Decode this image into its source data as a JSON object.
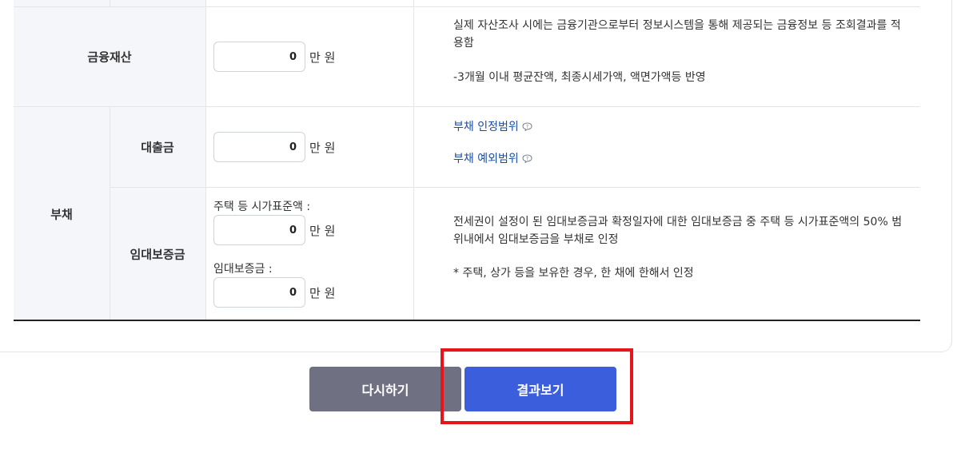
{
  "rows": {
    "financial_assets": {
      "label": "금융재산",
      "value": "0",
      "unit": "만 원",
      "desc_line1": "실제 자산조사 시에는 금융기관으로부터 정보시스템을 통해 제공되는 금융정보 등 조회결과를 적용함",
      "desc_line2": "-3개월 이내 평균잔액, 최종시세가액, 액면가액등 반영"
    },
    "debt": {
      "label": "부채",
      "loan": {
        "label": "대출금",
        "value": "0",
        "unit": "만 원",
        "link1": "부채 인정범위",
        "link2": "부채 예외범위"
      },
      "deposit": {
        "label": "임대보증금",
        "sub1": "주택 등 시가표준액 :",
        "value1": "0",
        "unit1": "만 원",
        "sub2": "임대보증금 :",
        "value2": "0",
        "unit2": "만 원",
        "desc_line1": "전세권이 설정이 된 임대보증금과 확정일자에 대한 임대보증금 중 주택 등 시가표준액의 50% 범위내에서 임대보증금을 부채로 인정",
        "desc_line2": "* 주택, 상가 등을 보유한 경우, 한 채에 한해서 인정"
      }
    }
  },
  "buttons": {
    "reset": "다시하기",
    "result": "결과보기"
  },
  "colors": {
    "label_bg": "#f5f6fa",
    "reset_btn": "#6f7182",
    "result_btn": "#3b5fdc",
    "link": "#1a4fa0",
    "highlight": "#e8141c"
  },
  "icons": {
    "help": "question-bubble-icon"
  }
}
